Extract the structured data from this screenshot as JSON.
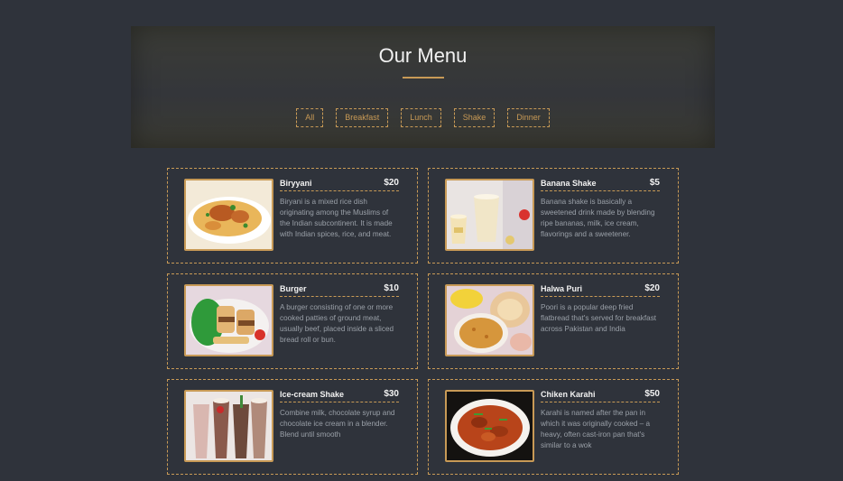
{
  "header": {
    "title": "Our Menu"
  },
  "filters": [
    "All",
    "Breakfast",
    "Lunch",
    "Shake",
    "Dinner"
  ],
  "items": [
    {
      "name": "Biryyani",
      "price": "$20",
      "desc": "Biryani is a mixed rice dish originating among the Muslims of the Indian subcontinent. It is made with Indian spices, rice, and meat.",
      "image": "biryani"
    },
    {
      "name": "Banana Shake",
      "price": "$5",
      "desc": "Banana shake is basically a sweetened drink made by blending ripe bananas, milk, ice cream, flavorings and a sweetener.",
      "image": "banana-shake"
    },
    {
      "name": "Burger",
      "price": "$10",
      "desc": "A burger consisting of one or more cooked patties of ground meat, usually beef, placed inside a sliced bread roll or bun.",
      "image": "burger"
    },
    {
      "name": "Halwa Puri",
      "price": "$20",
      "desc": "Poori is a popular deep fried flatbread that's served for breakfast across Pakistan and India",
      "image": "halwa-puri"
    },
    {
      "name": "Ice-cream Shake",
      "price": "$30",
      "desc": "Combine milk, chocolate syrup and chocolate ice cream in a blender. Blend until smooth",
      "image": "icecream-shake"
    },
    {
      "name": "Chiken Karahi",
      "price": "$50",
      "desc": "Karahi is named after the pan in which it was originally cooked – a heavy, often cast-iron pan that's similar to a wok",
      "image": "chicken-karahi"
    }
  ],
  "colors": {
    "accent": "#c89a56",
    "background": "#2f333b",
    "text_muted": "#9aa0a8"
  }
}
